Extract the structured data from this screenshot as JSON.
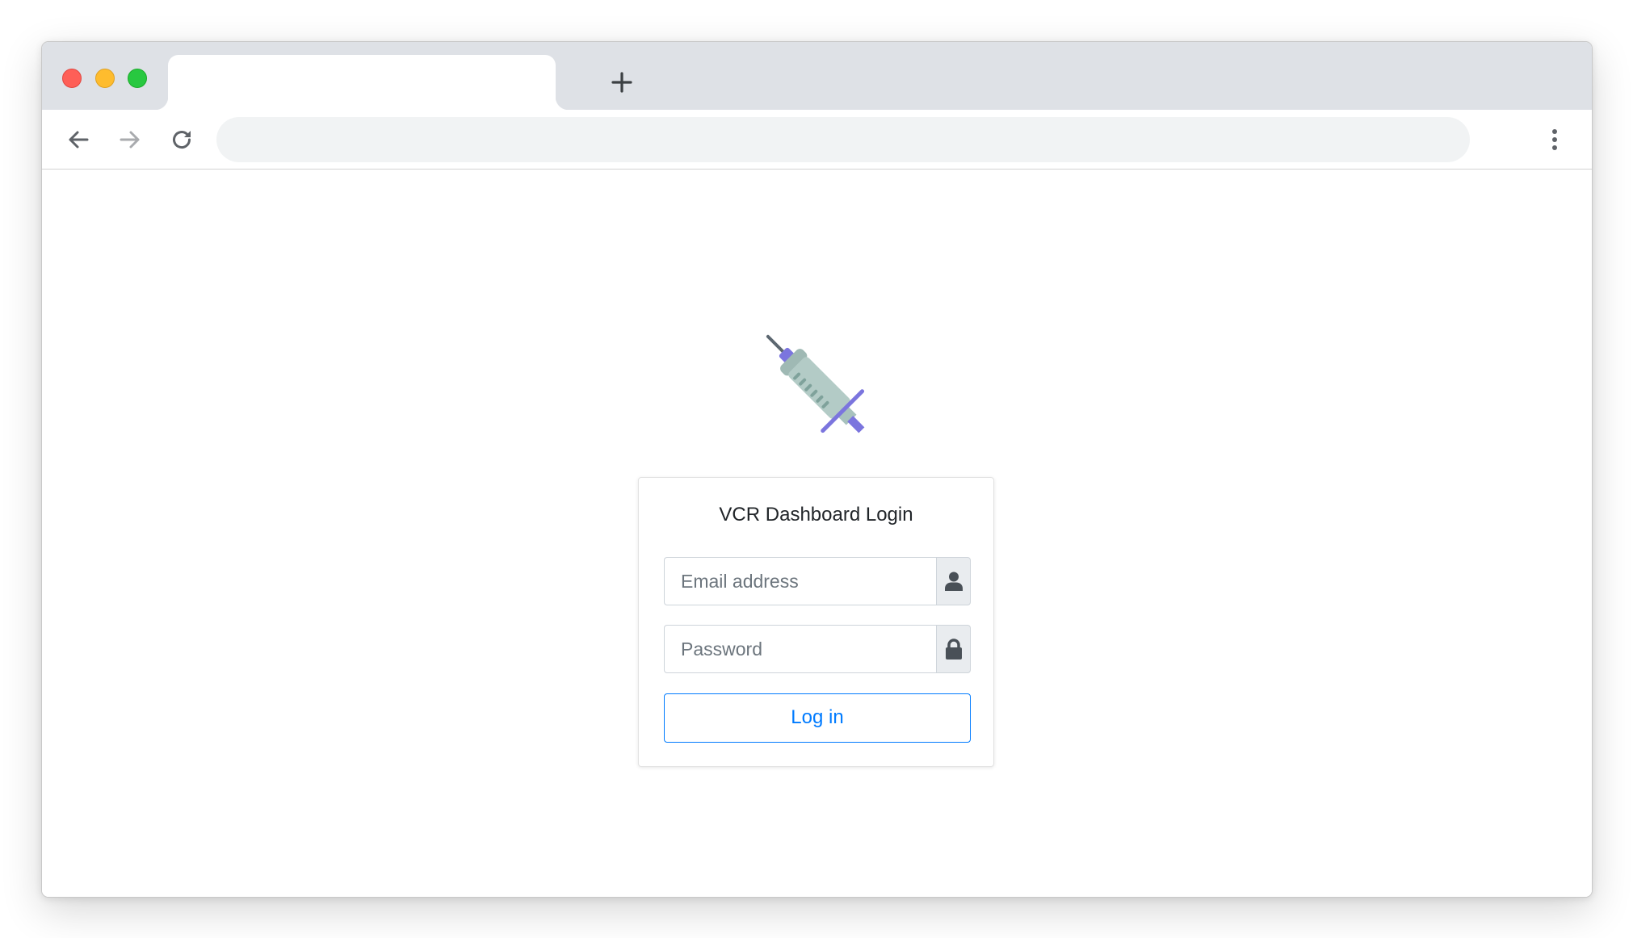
{
  "browser": {
    "tab_title": "",
    "address_bar": "",
    "icons": {
      "close": "traffic-light-red",
      "minimize": "traffic-light-yellow",
      "maximize": "traffic-light-green",
      "new_tab": "plus-icon",
      "back": "arrow-left-icon",
      "forward": "arrow-right-icon",
      "reload": "reload-icon",
      "menu": "kebab-menu-icon"
    }
  },
  "page": {
    "logo_icon": "syringe-icon",
    "login": {
      "title": "VCR Dashboard Login",
      "email": {
        "placeholder": "Email address",
        "value": "",
        "icon": "user-icon"
      },
      "password": {
        "placeholder": "Password",
        "value": "",
        "icon": "lock-icon"
      },
      "submit_label": "Log in"
    }
  },
  "colors": {
    "primary": "#007bff",
    "tabbar": "#dee1e6",
    "omnibox": "#f1f3f4",
    "addon_bg": "#e9ecef",
    "syringe_barrel": "#b3cbc6",
    "syringe_accent": "#7b75de"
  }
}
